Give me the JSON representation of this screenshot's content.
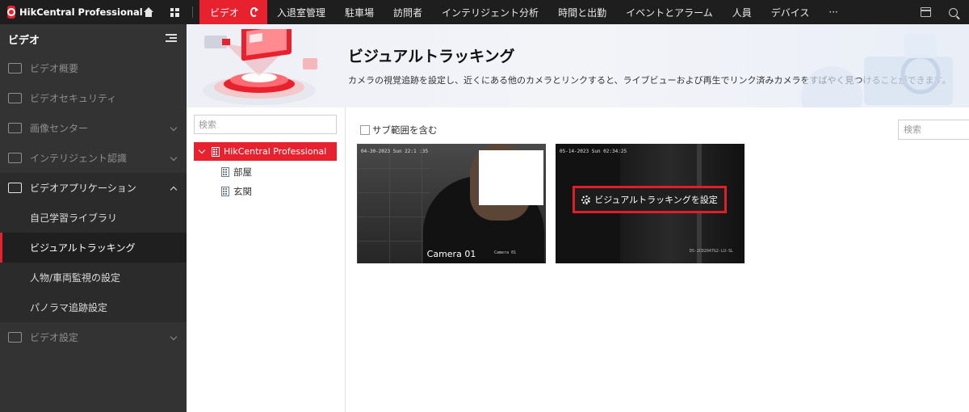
{
  "app": {
    "brand": "HikCentral Professional"
  },
  "topnav": {
    "items": [
      {
        "label": "ビデオ",
        "active": true
      },
      {
        "label": "入退室管理"
      },
      {
        "label": "駐車場"
      },
      {
        "label": "訪問者"
      },
      {
        "label": "インテリジェント分析"
      },
      {
        "label": "時間と出勤"
      },
      {
        "label": "イベントとアラーム"
      },
      {
        "label": "人員"
      },
      {
        "label": "デバイス"
      },
      {
        "label": "···"
      }
    ],
    "icons": [
      "home-icon",
      "grid-icon",
      "refresh-icon",
      "calendar-icon",
      "search-icon"
    ]
  },
  "sidebar": {
    "title": "ビデオ",
    "items": [
      {
        "label": "ビデオ概要",
        "icon": "monitor-icon",
        "has_chevron": false
      },
      {
        "label": "ビデオセキュリティ",
        "icon": "screen-icon",
        "has_chevron": false
      },
      {
        "label": "画像センター",
        "icon": "image-icon",
        "has_chevron": true
      },
      {
        "label": "インテリジェント認識",
        "icon": "recognition-icon",
        "has_chevron": true
      },
      {
        "label": "ビデオアプリケーション",
        "icon": "video-app-icon",
        "has_chevron": true,
        "expanded": true
      }
    ],
    "subitems": [
      {
        "label": "自己学習ライブラリ"
      },
      {
        "label": "ビジュアルトラッキング",
        "active": true
      },
      {
        "label": "人物/車両監視の設定"
      },
      {
        "label": "パノラマ追跡設定"
      }
    ],
    "last_item": {
      "label": "ビデオ設定",
      "icon": "video-settings-icon",
      "has_chevron": true
    }
  },
  "banner": {
    "title": "ビジュアルトラッキング",
    "description": "カメラの視覚追跡を設定し、近くにある他のカメラとリンクすると、ライブビューおよび再生でリンク済みカメラをすばやく見つけることができます。"
  },
  "tree": {
    "search_placeholder": "検索",
    "root": "HikCentral Professional",
    "children": [
      "部屋",
      "玄関"
    ]
  },
  "main": {
    "include_subarea_label": "サブ範囲を含む",
    "include_subarea_checked": false,
    "search_placeholder": "検索",
    "cameras": [
      {
        "name": "Camera 01",
        "osd_time": "04-30-2023 Sun 22:1 :35",
        "osd_name": "Camera 01"
      },
      {
        "name": "",
        "osd_time": "05-14-2023 Sun 02:34:25",
        "osd_name": "DS-2CD2047G2-LU-SL",
        "action_label": "ビジュアルトラッキングを設定"
      }
    ]
  },
  "colors": {
    "accent": "#e8212e",
    "topbar_bg": "#1e1e1e",
    "sidebar_bg": "#333333"
  }
}
